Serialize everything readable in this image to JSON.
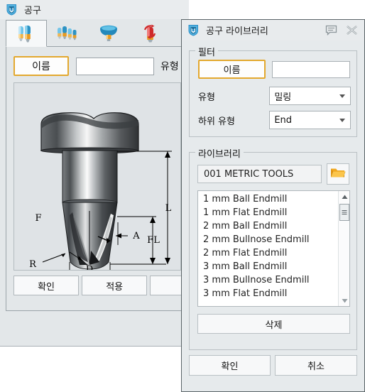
{
  "main_window": {
    "title": "공구",
    "icon": "tool-shield-icon",
    "tabs": [
      {
        "name": "tab-tool-single",
        "icon": "single-tool-icon",
        "active": true
      },
      {
        "name": "tab-tool-group",
        "icon": "multi-tool-icon",
        "active": false
      },
      {
        "name": "tab-tool-holder",
        "icon": "holder-icon",
        "active": false
      },
      {
        "name": "tab-tool-rotation",
        "icon": "rotation-tool-icon",
        "active": false
      }
    ],
    "form": {
      "name_button_label": "이름",
      "name_value": "",
      "name_placeholder": "",
      "type_label": "유형"
    },
    "diagram": {
      "labels": {
        "flute_length": "F",
        "corner_radius": "R",
        "diameter": "D",
        "angle": "A",
        "cutting_length": "FL",
        "overall_length": "L"
      }
    },
    "buttons": [
      {
        "name": "ok-button",
        "label": "확인"
      },
      {
        "name": "apply-button",
        "label": "적용"
      },
      {
        "name": "third-button",
        "label": ""
      }
    ]
  },
  "dialog": {
    "title": "공구 라이브러리",
    "icon": "tool-shield-icon",
    "titlebar_buttons": [
      {
        "name": "help-icon",
        "glyph": "help-balloon"
      },
      {
        "name": "close-icon",
        "glyph": "close-x"
      }
    ],
    "filter": {
      "group_title": "필터",
      "name_button_label": "이름",
      "name_value": "",
      "type_label": "유형",
      "type_value": "밀링",
      "subtype_label": "하위 유형",
      "subtype_value": "End"
    },
    "library": {
      "group_title": "라이브러리",
      "selected_library": "001 METRIC TOOLS",
      "folder_button_icon": "folder-open-icon",
      "items": [
        "1 mm Ball Endmill",
        "1 mm Flat Endmill",
        "2 mm Ball Endmill",
        "2 mm Bullnose Endmill",
        "2 mm Flat Endmill",
        "3 mm Ball Endmill",
        "3 mm Bullnose Endmill",
        "3 mm Flat Endmill"
      ],
      "scrollbar": {
        "up_icon": "scroll-up-arrow-icon",
        "down_icon": "scroll-down-arrow-icon",
        "thumb": "scroll-thumb"
      }
    },
    "delete_button_label": "삭제",
    "ok_button_label": "확인",
    "cancel_button_label": "취소"
  },
  "colors": {
    "accent_orange": "#e3a82e",
    "window_bg": "#e3e7e9",
    "dialog_bg": "#e6eaec",
    "folder_yellow": "#f0a81e",
    "tool_blue": "#2d93c4",
    "tool_red": "#cf2a2a"
  }
}
